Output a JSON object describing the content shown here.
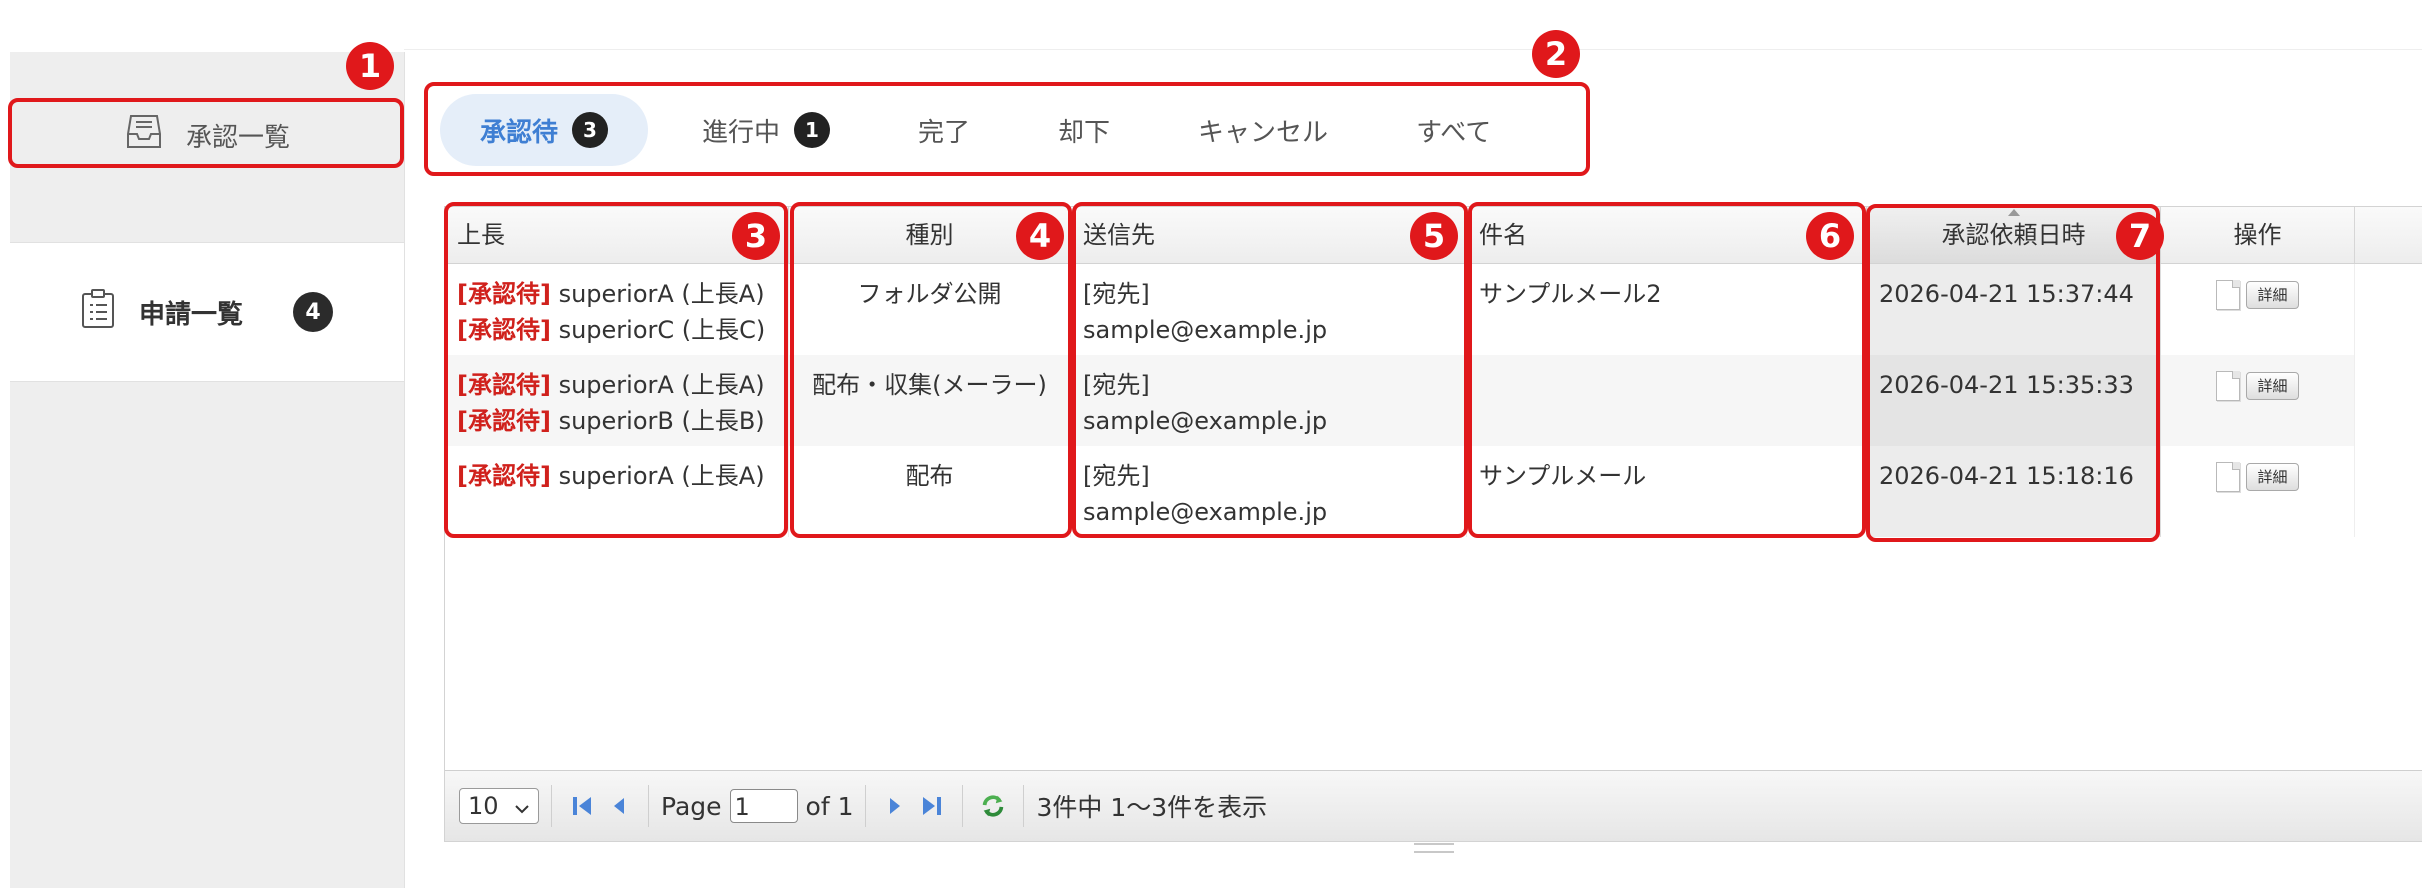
{
  "sidebar": {
    "items": [
      {
        "label": "承認一覧",
        "icon": "inbox-tray-icon"
      },
      {
        "label": "申請一覧",
        "icon": "clipboard-list-icon",
        "badge": "4"
      }
    ]
  },
  "tabs": [
    {
      "label": "承認待",
      "badge": "3",
      "active": true
    },
    {
      "label": "進行中",
      "badge": "1"
    },
    {
      "label": "完了"
    },
    {
      "label": "却下"
    },
    {
      "label": "キャンセル"
    },
    {
      "label": "すべて"
    }
  ],
  "table": {
    "columns": [
      "上長",
      "種別",
      "送信先",
      "件名",
      "承認依頼日時",
      "操作"
    ],
    "rows": [
      {
        "superiors": [
          {
            "status": "[承認待]",
            "name": "superiorA (上長A)"
          },
          {
            "status": "[承認待]",
            "name": "superiorC (上長C)"
          }
        ],
        "type": "フォルダ公開",
        "dest_label": "[宛先]",
        "dest_email": "sample@example.jp",
        "subject": "サンプルメール2",
        "requested_at": "2026-04-21 15:37:44",
        "op_label": "詳細"
      },
      {
        "superiors": [
          {
            "status": "[承認待]",
            "name": "superiorA (上長A)"
          },
          {
            "status": "[承認待]",
            "name": "superiorB (上長B)"
          }
        ],
        "type": "配布・収集(メーラー)",
        "dest_label": "[宛先]",
        "dest_email": "sample@example.jp",
        "subject": "",
        "requested_at": "2026-04-21 15:35:33",
        "op_label": "詳細"
      },
      {
        "superiors": [
          {
            "status": "[承認待]",
            "name": "superiorA (上長A)"
          },
          {
            "status": "",
            "name": ""
          }
        ],
        "type": "配布",
        "dest_label": "[宛先]",
        "dest_email": "sample@example.jp",
        "subject": "サンプルメール",
        "requested_at": "2026-04-21 15:18:16",
        "op_label": "詳細"
      }
    ]
  },
  "pager": {
    "rows_per_page": "10",
    "page_label": "Page",
    "page_value": "1",
    "of_label": "of 1",
    "summary": "3件中 1〜3件を表示"
  },
  "annotations": [
    "1",
    "2",
    "3",
    "4",
    "5",
    "6",
    "7"
  ],
  "colors": {
    "accent": "#3f7fd3",
    "status": "#d0211c",
    "annotation": "#e0181b"
  }
}
